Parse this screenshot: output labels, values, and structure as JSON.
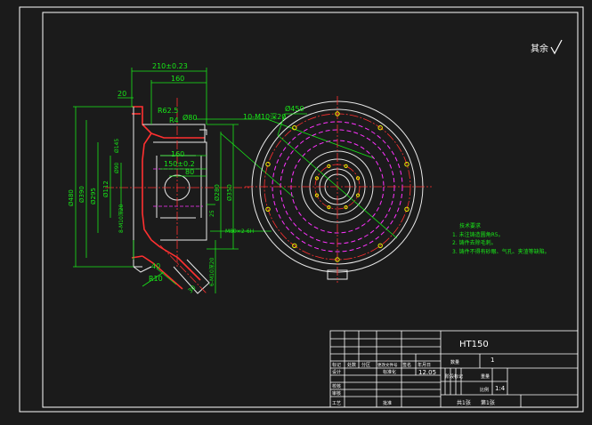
{
  "title_block": {
    "material": "HT150",
    "row_labels": [
      "标记",
      "设计",
      "校核",
      "审核",
      "工艺"
    ],
    "header_cells": [
      "处数",
      "分区",
      "更改文件号",
      "签名",
      "年月日"
    ],
    "standardization": "标准化",
    "date": "12.05",
    "approve": "批准",
    "weight_label": "重量",
    "count_label": "数量",
    "count_value": "1",
    "scale_label": "比例",
    "scale_value": "1:4",
    "stage_label": "阶段标记",
    "sheets_total": "共1张",
    "sheet_no": "第1张"
  },
  "roughness_note": "其余",
  "tech_req": {
    "title": "技术要求",
    "items": [
      "1. 未注铸造圆角R5。",
      "2. 铸件去除毛刺。",
      "3. 铸件不得有砂眼、气孔、夹渣等缺陷。"
    ]
  },
  "dims": {
    "d210": "210±0.23",
    "d160_top": "160",
    "d20": "20",
    "r62": "R62.5",
    "r4": "R4",
    "d80_top": "Ø80",
    "holes": "10-M10深20",
    "d450": "Ø450",
    "d160_mid": "160",
    "d150": "150±0.2",
    "d80_mid": "80",
    "d480": "Ø480",
    "d390": "Ø390",
    "d295": "Ø295",
    "d145": "Ø145",
    "d90": "Ø90",
    "d112": "Ø112",
    "d280": "Ø280",
    "d350": "Ø350",
    "d25": "25",
    "m80": "M80×2-6H",
    "r10": "R10",
    "d40": "40",
    "d8": "8-M10深20",
    "d6": "6-M10深20",
    "d30": "30"
  },
  "colors": {
    "background": "#1b1b1b",
    "border": "#ffffff",
    "outline": "#e8e8e8",
    "dimension": "#18e818",
    "center": "#ff3030",
    "hidden": "#ff33ff",
    "hole": "#f0f000"
  }
}
